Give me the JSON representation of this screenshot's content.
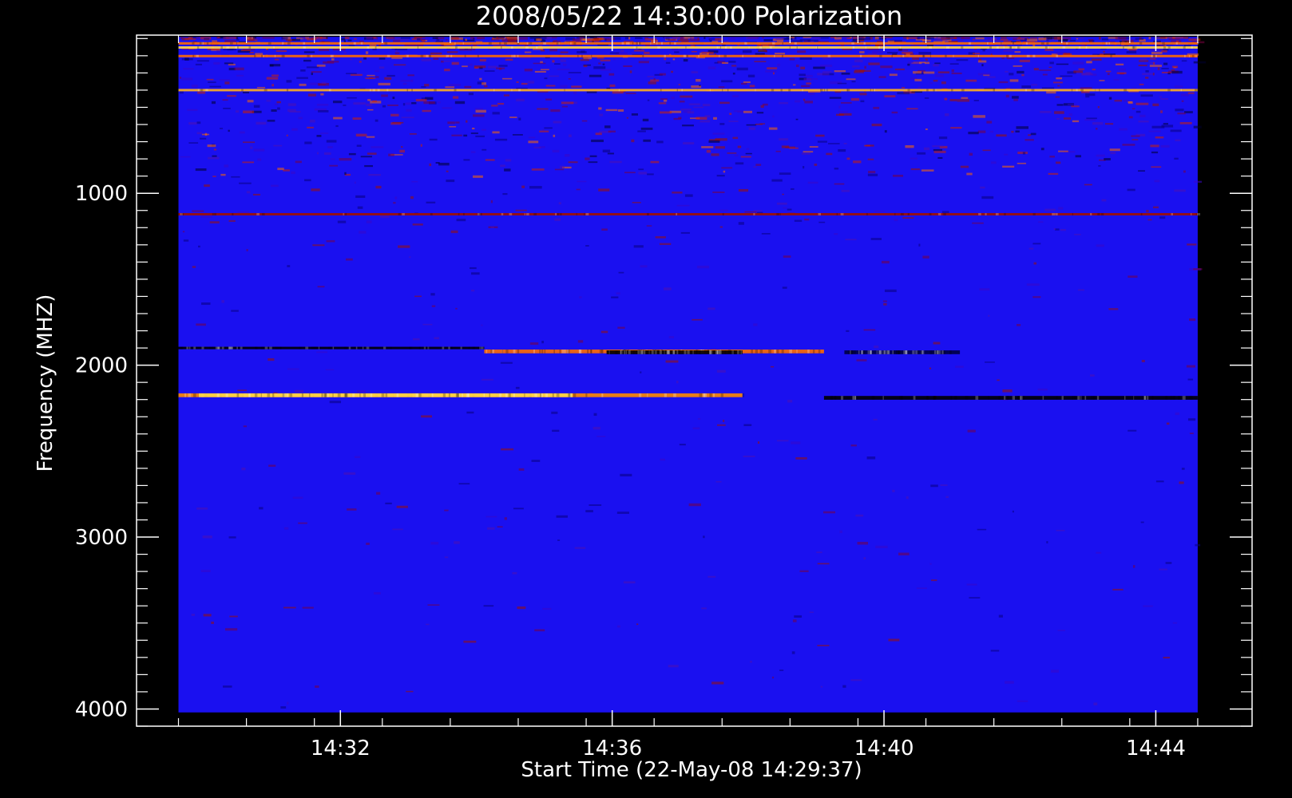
{
  "chart_data": {
    "type": "heatmap",
    "title": "2008/05/22 14:30:00 Polarization",
    "xlabel": "Start Time (22-May-08 14:29:37)",
    "ylabel": "Frequency (MHZ)",
    "x_ticks": [
      "14:32",
      "14:36",
      "14:40",
      "14:44"
    ],
    "x_tick_minutes": [
      2.383,
      6.383,
      10.383,
      14.383
    ],
    "y_ticks": [
      1000,
      2000,
      3000,
      4000
    ],
    "y_minor_step": 100,
    "x_minor_step_minutes": 1,
    "x_range_minutes": [
      -0.617,
      15.8
    ],
    "y_range": [
      80,
      4100
    ],
    "data_x_range_minutes": [
      0,
      15
    ],
    "data_y_range": [
      90,
      4020
    ],
    "y_axis_inverted": true,
    "background_color": "#1a10f0",
    "band_colors": [
      "#000000",
      "#7a0000",
      "#d01000",
      "#ff6a00",
      "#ffd84a",
      "#ffffff"
    ],
    "bands": [
      {
        "freq": 125,
        "width": 8,
        "start_min": 0,
        "end_min": 15,
        "color": "#ff6a00"
      },
      {
        "freq": 150,
        "width": 10,
        "start_min": 0,
        "end_min": 15,
        "color": "#ffd84a"
      },
      {
        "freq": 200,
        "width": 10,
        "start_min": 0,
        "end_min": 15,
        "color": "#ff6a00"
      },
      {
        "freq": 400,
        "width": 14,
        "start_min": 0,
        "end_min": 15,
        "color": "#ffb020"
      },
      {
        "freq": 1120,
        "width": 10,
        "start_min": 0,
        "end_min": 15,
        "color": "#a01000"
      },
      {
        "freq": 1900,
        "width": 14,
        "start_min": 0,
        "end_min": 4.5,
        "color": "#000000"
      },
      {
        "freq": 1920,
        "width": 22,
        "start_min": 4.5,
        "end_min": 9.5,
        "color": "#ff6a00"
      },
      {
        "freq": 1925,
        "width": 22,
        "start_min": 6.3,
        "end_min": 8.3,
        "color": "#000000"
      },
      {
        "freq": 1925,
        "width": 22,
        "start_min": 9.8,
        "end_min": 11.5,
        "color": "#000044"
      },
      {
        "freq": 2175,
        "width": 22,
        "start_min": 0,
        "end_min": 8.3,
        "color": "#ff8a00"
      },
      {
        "freq": 2175,
        "width": 22,
        "start_min": 0.3,
        "end_min": 5.8,
        "color": "#ffd84a"
      },
      {
        "freq": 2190,
        "width": 22,
        "start_min": 9.5,
        "end_min": 15,
        "color": "#000000"
      }
    ]
  }
}
